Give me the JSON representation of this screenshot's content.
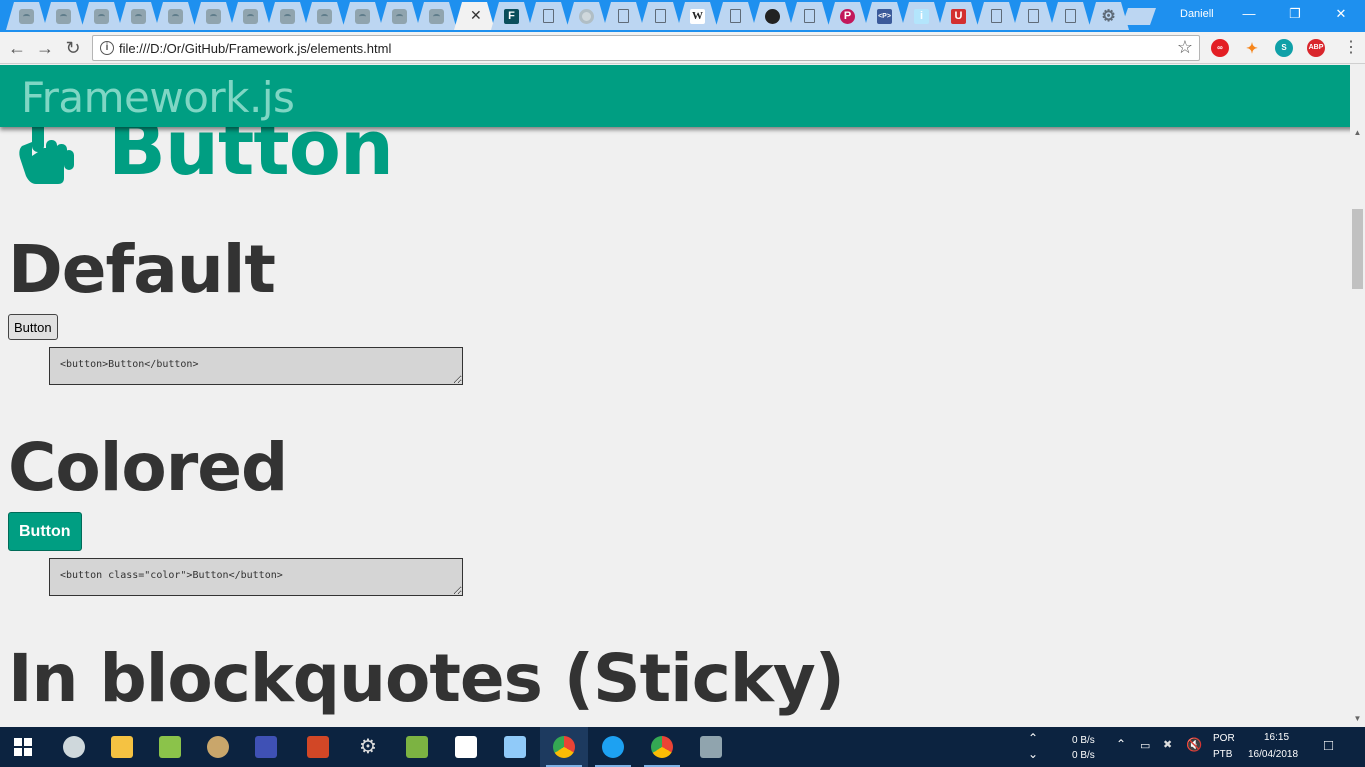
{
  "browser": {
    "tabs": [
      {
        "icon": "sad-folder-icon"
      },
      {
        "icon": "sad-folder-icon"
      },
      {
        "icon": "sad-folder-icon"
      },
      {
        "icon": "sad-folder-icon"
      },
      {
        "icon": "sad-folder-icon"
      },
      {
        "icon": "sad-folder-icon"
      },
      {
        "icon": "sad-folder-icon"
      },
      {
        "icon": "sad-folder-icon"
      },
      {
        "icon": "sad-folder-icon"
      },
      {
        "icon": "sad-folder-icon"
      },
      {
        "icon": "sad-folder-icon"
      },
      {
        "icon": "sad-folder-icon"
      },
      {
        "icon": "close-icon",
        "active": true
      },
      {
        "icon": "framework-icon",
        "glyph": "F"
      },
      {
        "icon": "document-icon"
      },
      {
        "icon": "disc-icon"
      },
      {
        "icon": "document-icon"
      },
      {
        "icon": "document-icon"
      },
      {
        "icon": "wikipedia-icon",
        "glyph": "W"
      },
      {
        "icon": "document-icon"
      },
      {
        "icon": "github-icon"
      },
      {
        "icon": "document-icon"
      },
      {
        "icon": "picsart-icon",
        "glyph": "P"
      },
      {
        "icon": "codepen-icon",
        "glyph": "<P>"
      },
      {
        "icon": "info-icon",
        "glyph": "i"
      },
      {
        "icon": "uc-icon",
        "glyph": "U"
      },
      {
        "icon": "document-icon"
      },
      {
        "icon": "document-icon"
      },
      {
        "icon": "document-icon"
      },
      {
        "icon": "gear-icon"
      }
    ],
    "username": "Daniell",
    "url": "file:///D:/Or/GitHub/Framework.js/elements.html"
  },
  "page": {
    "brand": "Framework.js",
    "heading": "Button",
    "sections": [
      {
        "title": "Default",
        "button_label": "Button",
        "code": "<button>Button</button>"
      },
      {
        "title": "Colored",
        "button_label": "Button",
        "code": "<button class=\"color\">Button</button>"
      },
      {
        "title": "In blockquotes (Sticky)"
      }
    ]
  },
  "colors": {
    "accent": "#009e82",
    "chrome_blue": "#1e90ef",
    "taskbar": "#0c2340"
  },
  "taskbar": {
    "net_up": "0 B/s",
    "net_down": "0 B/s",
    "lang1": "POR",
    "lang2": "PTB",
    "time": "16:15",
    "date": "16/04/2018"
  }
}
